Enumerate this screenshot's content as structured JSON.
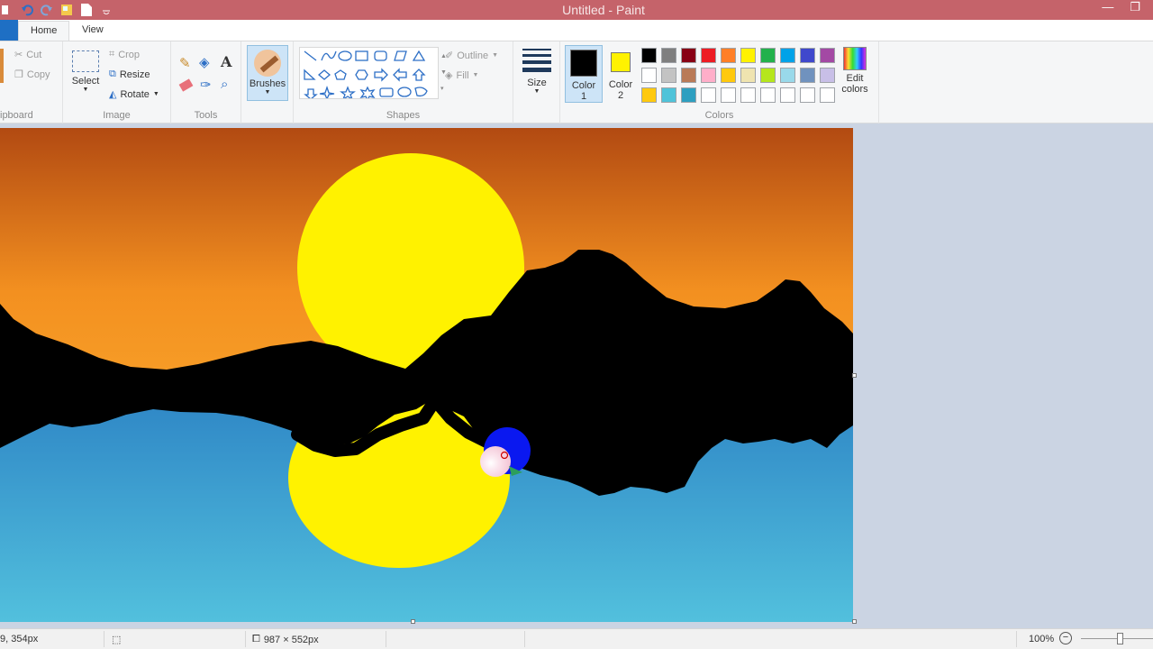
{
  "window": {
    "title": "Untitled - Paint"
  },
  "tabs": {
    "home": "Home",
    "view": "View"
  },
  "clipboard": {
    "cut": "Cut",
    "copy": "Copy",
    "group": "ipboard"
  },
  "image": {
    "select": "Select",
    "crop": "Crop",
    "resize": "Resize",
    "rotate": "Rotate",
    "group": "Image"
  },
  "tools": {
    "group": "Tools",
    "text_icon": "A"
  },
  "brushes": {
    "label": "Brushes"
  },
  "shapes": {
    "group": "Shapes",
    "outline": "Outline",
    "fill": "Fill"
  },
  "size": {
    "label": "Size"
  },
  "colors": {
    "color1_label": "Color",
    "color1_num": "1",
    "color2_label": "Color",
    "color2_num": "2",
    "color1": "#000000",
    "color2": "#fff200",
    "edit_label": "Edit",
    "edit_label2": "colors",
    "group": "Colors",
    "palette_row1": [
      "#000000",
      "#7f7f7f",
      "#880015",
      "#ed1c24",
      "#ff7f27",
      "#fff200",
      "#22b14c",
      "#00a2e8",
      "#3f48cc",
      "#a349a4"
    ],
    "palette_row2": [
      "#ffffff",
      "#c3c3c3",
      "#b97a57",
      "#ffaec9",
      "#ffc90e",
      "#efe4b0",
      "#b5e61d",
      "#99d9ea",
      "#7092be",
      "#c8bfe7"
    ],
    "palette_row3": [
      "#ffc90e",
      "#4fc3d9",
      "#2e9fc0",
      "#ffffff",
      "#ffffff",
      "#ffffff",
      "#ffffff",
      "#ffffff",
      "#ffffff",
      "#ffffff"
    ]
  },
  "status": {
    "cursor_pos": "9, 354px",
    "canvas_size": "987 × 552px",
    "zoom": "100%"
  }
}
